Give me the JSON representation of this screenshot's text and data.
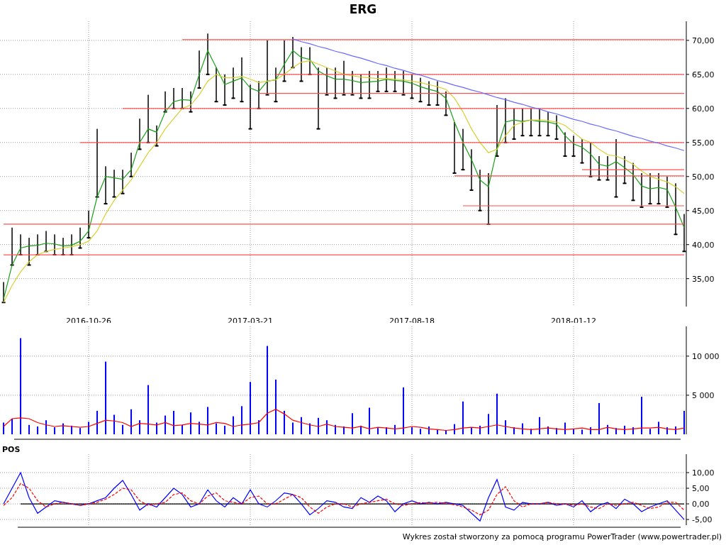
{
  "title": "ERG",
  "price_panel": {
    "chart_data": {
      "type": "line",
      "grid": true,
      "ylim": [
        30.9,
        72.8
      ],
      "categories": [
        null,
        null,
        null,
        null,
        null,
        null,
        null,
        null,
        null,
        null,
        "2016-10-26",
        null,
        null,
        null,
        null,
        null,
        null,
        null,
        null,
        null,
        null,
        null,
        null,
        null,
        null,
        null,
        null,
        null,
        null,
        "2017-03-21",
        null,
        null,
        null,
        null,
        null,
        null,
        null,
        null,
        null,
        null,
        null,
        null,
        null,
        null,
        null,
        null,
        null,
        null,
        "2017-08-18",
        null,
        null,
        null,
        null,
        null,
        null,
        null,
        null,
        null,
        null,
        null,
        null,
        null,
        null,
        null,
        null,
        null,
        null,
        "2018-01-12",
        null,
        null,
        null,
        null,
        null,
        null,
        null,
        null,
        null,
        null,
        null,
        null,
        null
      ],
      "yticks": [
        {
          "value": 35,
          "label": "35,00"
        },
        {
          "value": 40,
          "label": "40,00"
        },
        {
          "value": 45,
          "label": "45,00"
        },
        {
          "value": 50,
          "label": "50,00"
        },
        {
          "value": 55,
          "label": "55,00"
        },
        {
          "value": 60,
          "label": "60,00"
        },
        {
          "value": 65,
          "label": "65,00"
        },
        {
          "value": 70,
          "label": "70,00"
        }
      ],
      "series": [
        {
          "type": "area",
          "color": "#000000",
          "values": [
            34.5,
            42.5,
            41.5,
            41,
            41.5,
            42,
            41.5,
            41,
            41.5,
            42.5,
            45,
            57,
            51.5,
            51,
            51,
            53.5,
            58.5,
            62,
            57.5,
            62.5,
            63,
            63,
            62.5,
            68.5,
            71,
            66,
            65,
            66,
            67.5,
            63.5,
            64,
            70,
            66,
            70,
            70.5,
            69,
            69,
            66,
            66,
            66,
            67,
            65.5,
            65,
            65.5,
            65.5,
            66,
            65.5,
            65.5,
            65,
            64.5,
            64,
            64,
            62.5,
            58,
            57,
            54,
            51,
            50.5,
            60.5,
            61.5,
            60,
            60,
            60,
            60,
            59.5,
            59,
            56.5,
            56,
            55.5,
            55,
            53,
            53,
            55.5,
            53,
            52,
            50.5,
            50.5,
            50.5,
            50,
            49,
            44.5
          ]
        },
        {
          "type": "scatter",
          "color": "#000000",
          "values": [
            31.5,
            37,
            38.5,
            37,
            38.5,
            39,
            38.5,
            38.5,
            38.5,
            39.5,
            41,
            47,
            46,
            47,
            47.5,
            50,
            54,
            55,
            54.5,
            59.5,
            60,
            60,
            59.5,
            63,
            65,
            61,
            60.5,
            61.5,
            61,
            57,
            60,
            62,
            61,
            64,
            66,
            64,
            65,
            57,
            62,
            61.5,
            62,
            62,
            61.5,
            61.5,
            62.5,
            62.5,
            62.5,
            62,
            61.5,
            61,
            60.5,
            60.5,
            59,
            50.5,
            51,
            48,
            45,
            43,
            53,
            55,
            55.5,
            56,
            56,
            56,
            56,
            55.5,
            53,
            53,
            52,
            50,
            49.5,
            49.5,
            47,
            49,
            46.5,
            45.5,
            46,
            46,
            45.5,
            41.5,
            39
          ]
        },
        {
          "line_style": "solid",
          "color": "#1aa01a",
          "values": [
            32,
            37,
            39.5,
            39.8,
            39.9,
            40.2,
            40.1,
            39.8,
            39.9,
            40.5,
            42,
            47,
            50,
            49.8,
            49.6,
            51,
            55,
            57,
            56.5,
            59.5,
            61,
            61.3,
            61.2,
            65,
            68.5,
            66,
            63.5,
            64,
            64.5,
            63,
            62.5,
            64,
            64.2,
            66.5,
            68.5,
            67.5,
            67.2,
            65.5,
            64.8,
            64.3,
            64.3,
            64.1,
            63.8,
            63.9,
            64,
            64.3,
            64.1,
            64,
            63.7,
            63.2,
            62.8,
            62.5,
            61.5,
            58,
            55,
            52.5,
            49.5,
            48.5,
            54,
            58,
            58.3,
            58.1,
            58.3,
            58.1,
            58,
            57.7,
            56,
            54.8,
            54.3,
            53.3,
            51.8,
            51.5,
            52.2,
            51.3,
            50.3,
            48.6,
            48.2,
            48.4,
            48.1,
            45.5,
            42.5
          ]
        },
        {
          "line_style": "solid",
          "color": "#d8d030",
          "values": [
            31.5,
            34,
            36,
            37.5,
            38.5,
            39,
            39.3,
            39.5,
            39.7,
            40,
            40.5,
            42,
            44.5,
            46.5,
            48,
            49.5,
            51.5,
            53.5,
            55,
            57,
            58.5,
            60,
            60.5,
            62,
            64,
            65,
            64.5,
            64.5,
            64.7,
            64.3,
            63.8,
            64,
            64.2,
            65,
            66,
            66.8,
            67,
            66.5,
            66,
            65.5,
            65,
            64.8,
            64.6,
            64.5,
            64.4,
            64.4,
            64.3,
            64.2,
            64,
            63.8,
            63.5,
            63.2,
            62.8,
            61.5,
            59.5,
            57,
            55,
            53.5,
            54,
            56,
            57.5,
            58,
            58.3,
            58.3,
            58.2,
            58,
            57.5,
            56.5,
            55.5,
            55,
            54,
            53.2,
            53,
            52.5,
            51.8,
            50.8,
            50,
            49.6,
            49.2,
            48.5,
            47.5
          ]
        },
        {
          "line_style": "solid",
          "color": "#ff5050",
          "values": [
            null,
            null,
            null,
            null,
            null,
            null,
            null,
            null,
            null,
            null,
            null,
            null,
            null,
            null,
            null,
            null,
            null,
            null,
            null,
            null,
            null,
            70.1,
            70.1,
            70.1,
            70.1,
            70.1,
            70.1,
            70.1,
            70.1,
            70.1,
            70.1,
            70.1,
            70.1,
            70.1,
            70.1,
            70.1,
            70.1,
            70.1,
            70.1,
            70.1,
            70.1,
            70.1,
            70.1,
            70.1,
            70.1,
            70.1,
            70.1,
            70.1,
            70.1,
            70.1,
            70.1,
            70.1,
            70.1,
            70.1,
            70.1,
            70.1,
            70.1,
            70.1,
            70.1,
            70.1,
            70.1,
            70.1,
            70.1,
            70.1,
            70.1,
            70.1,
            70.1,
            70.1,
            70.1,
            70.1,
            70.1,
            70.1,
            70.1,
            70.1,
            70.1,
            70.1,
            70.1,
            70.1,
            70.1,
            70.1,
            70.1
          ]
        },
        {
          "line_style": "solid",
          "color": "#ff5050",
          "values": [
            null,
            null,
            null,
            null,
            null,
            null,
            null,
            null,
            null,
            null,
            null,
            null,
            null,
            null,
            null,
            null,
            null,
            null,
            null,
            null,
            null,
            null,
            null,
            null,
            null,
            null,
            null,
            null,
            null,
            null,
            null,
            null,
            65,
            65,
            65,
            65,
            65,
            65,
            65,
            65,
            65,
            65,
            65,
            65,
            65,
            65,
            65,
            65,
            65,
            65,
            65,
            65,
            65,
            65,
            65,
            65,
            65,
            65,
            65,
            65,
            65,
            65,
            65,
            65,
            65,
            65,
            65,
            65,
            65,
            65,
            65,
            65,
            65,
            65,
            65,
            65,
            65,
            65,
            65,
            65,
            65
          ]
        },
        {
          "line_style": "solid",
          "color": "#ff5050",
          "values": [
            null,
            null,
            null,
            null,
            null,
            null,
            null,
            null,
            null,
            null,
            null,
            null,
            null,
            null,
            null,
            null,
            null,
            null,
            null,
            null,
            null,
            null,
            null,
            null,
            null,
            null,
            null,
            null,
            null,
            null,
            62.2,
            62.2,
            62.2,
            62.2,
            62.2,
            62.2,
            62.2,
            62.2,
            62.2,
            62.2,
            62.2,
            62.2,
            62.2,
            62.2,
            62.2,
            62.2,
            62.2,
            62.2,
            62.2,
            62.2,
            62.2,
            62.2,
            62.2,
            62.2,
            62.2,
            62.2,
            62.2,
            62.2,
            62.2,
            62.2,
            62.2,
            62.2,
            62.2,
            62.2,
            62.2,
            62.2,
            62.2,
            62.2,
            62.2,
            62.2,
            62.2,
            62.2,
            62.2,
            62.2,
            62.2,
            62.2,
            62.2,
            62.2,
            62.2,
            62.2,
            62.2
          ]
        },
        {
          "line_style": "solid",
          "color": "#ff5050",
          "values": [
            null,
            null,
            null,
            null,
            null,
            null,
            null,
            null,
            null,
            null,
            null,
            null,
            null,
            null,
            60,
            60,
            60,
            60,
            60,
            60,
            60,
            60,
            60,
            60,
            60,
            60,
            60,
            60,
            60,
            60,
            60,
            60,
            60,
            60,
            60,
            60,
            60,
            60,
            60,
            60,
            60,
            60,
            60,
            60,
            60,
            60,
            60,
            60,
            60,
            60,
            60,
            60,
            60,
            60,
            60,
            60,
            60,
            60,
            60,
            60,
            60,
            60,
            60,
            60,
            60,
            60,
            60,
            60,
            60,
            60,
            60,
            60,
            60,
            60,
            60,
            60,
            60,
            60,
            60,
            60,
            60
          ]
        },
        {
          "line_style": "solid",
          "color": "#ff5050",
          "values": [
            null,
            null,
            null,
            null,
            null,
            null,
            null,
            null,
            null,
            55,
            55,
            55,
            55,
            55,
            55,
            55,
            55,
            55,
            55,
            55,
            55,
            55,
            55,
            55,
            55,
            55,
            55,
            55,
            55,
            55,
            55,
            55,
            55,
            55,
            55,
            55,
            55,
            55,
            55,
            55,
            55,
            55,
            55,
            55,
            55,
            55,
            55,
            55,
            55,
            55,
            55,
            55,
            55,
            55,
            55,
            55,
            55,
            55,
            55,
            55,
            55,
            55,
            55,
            55,
            55,
            55,
            55,
            55,
            55,
            55,
            55,
            55,
            55,
            55,
            55,
            55,
            55,
            55,
            55,
            55,
            55
          ]
        },
        {
          "line_style": "solid",
          "color": "#ff5050",
          "values": [
            null,
            null,
            null,
            null,
            null,
            null,
            null,
            null,
            null,
            null,
            null,
            null,
            null,
            null,
            null,
            null,
            null,
            null,
            null,
            null,
            null,
            null,
            null,
            null,
            null,
            null,
            null,
            null,
            null,
            null,
            null,
            null,
            null,
            null,
            null,
            null,
            null,
            null,
            null,
            null,
            null,
            null,
            null,
            null,
            null,
            null,
            null,
            null,
            null,
            null,
            null,
            null,
            null,
            null,
            null,
            null,
            null,
            null,
            null,
            null,
            null,
            null,
            null,
            null,
            null,
            null,
            null,
            null,
            51,
            51,
            51,
            51,
            51,
            51,
            51,
            51,
            51,
            51,
            51,
            51,
            51
          ]
        },
        {
          "line_style": "solid",
          "color": "#ff5050",
          "values": [
            null,
            null,
            null,
            null,
            null,
            null,
            null,
            null,
            null,
            null,
            null,
            null,
            null,
            null,
            null,
            null,
            null,
            null,
            null,
            null,
            null,
            null,
            null,
            null,
            null,
            null,
            null,
            null,
            null,
            null,
            null,
            null,
            null,
            null,
            null,
            null,
            null,
            null,
            null,
            null,
            null,
            null,
            null,
            null,
            null,
            null,
            null,
            null,
            null,
            null,
            null,
            null,
            null,
            50.1,
            50.1,
            50.1,
            50.1,
            50.1,
            50.1,
            50.1,
            50.1,
            50.1,
            50.1,
            50.1,
            50.1,
            50.1,
            50.1,
            50.1,
            50.1,
            50.1,
            50.1,
            50.1,
            50.1,
            50.1,
            50.1,
            50.1,
            50.1,
            50.1,
            50.1,
            50.1,
            50.1
          ]
        },
        {
          "line_style": "solid",
          "color": "#ff5050",
          "values": [
            null,
            null,
            null,
            null,
            null,
            null,
            null,
            null,
            null,
            null,
            null,
            null,
            null,
            null,
            null,
            null,
            null,
            null,
            null,
            null,
            null,
            null,
            null,
            null,
            null,
            null,
            null,
            null,
            null,
            null,
            null,
            null,
            null,
            null,
            null,
            null,
            null,
            null,
            null,
            null,
            null,
            null,
            null,
            null,
            null,
            null,
            null,
            null,
            null,
            null,
            null,
            null,
            null,
            null,
            45.7,
            45.7,
            45.7,
            45.7,
            45.7,
            45.7,
            45.7,
            45.7,
            45.7,
            45.7,
            45.7,
            45.7,
            45.7,
            45.7,
            45.7,
            45.7,
            45.7,
            45.7,
            45.7,
            45.7,
            45.7,
            45.7,
            45.7,
            45.7,
            45.7,
            45.7,
            45.7
          ]
        },
        {
          "line_style": "solid",
          "color": "#ff5050",
          "values": [
            43,
            43,
            43,
            43,
            43,
            43,
            43,
            43,
            43,
            43,
            43,
            43,
            43,
            43,
            43,
            43,
            43,
            43,
            43,
            43,
            43,
            43,
            43,
            43,
            43,
            43,
            43,
            43,
            43,
            43,
            43,
            43,
            43,
            43,
            43,
            43,
            43,
            43,
            43,
            43,
            43,
            43,
            43,
            43,
            43,
            43,
            43,
            43,
            43,
            43,
            43,
            43,
            43,
            43,
            43,
            43,
            43,
            43,
            43,
            43,
            43,
            43,
            43,
            43,
            43,
            43,
            43,
            43,
            43,
            43,
            43,
            43,
            43,
            43,
            43,
            43,
            43,
            43,
            43,
            43,
            43
          ]
        },
        {
          "line_style": "solid",
          "color": "#ff5050",
          "values": [
            38.5,
            38.5,
            38.5,
            38.5,
            38.5,
            38.5,
            38.5,
            38.5,
            38.5,
            38.5,
            38.5,
            38.5,
            38.5,
            38.5,
            38.5,
            38.5,
            38.5,
            38.5,
            38.5,
            38.5,
            38.5,
            38.5,
            38.5,
            38.5,
            38.5,
            38.5,
            38.5,
            38.5,
            38.5,
            38.5,
            38.5,
            38.5,
            38.5,
            38.5,
            38.5,
            38.5,
            38.5,
            38.5,
            38.5,
            38.5,
            38.5,
            38.5,
            38.5,
            38.5,
            38.5,
            38.5,
            38.5,
            38.5,
            38.5,
            38.5,
            38.5,
            38.5,
            38.5,
            38.5,
            38.5,
            38.5,
            38.5,
            38.5,
            38.5,
            38.5,
            38.5,
            38.5,
            38.5,
            38.5,
            38.5,
            38.5,
            38.5,
            38.5,
            38.5,
            38.5,
            38.5,
            38.5,
            38.5,
            38.5,
            38.5,
            38.5,
            38.5,
            38.5,
            38.5,
            38.5,
            38.5
          ]
        },
        {
          "line_style": "solid",
          "color": "#6a6aff",
          "values": [
            null,
            null,
            null,
            null,
            null,
            null,
            null,
            null,
            null,
            null,
            null,
            null,
            null,
            null,
            null,
            null,
            null,
            null,
            null,
            null,
            null,
            null,
            null,
            null,
            null,
            null,
            null,
            null,
            null,
            null,
            null,
            null,
            null,
            null,
            70.2,
            69.8,
            69.5,
            69.1,
            68.8,
            68.4,
            68.1,
            67.7,
            67.4,
            67,
            66.6,
            66.3,
            65.9,
            65.6,
            65.2,
            64.9,
            64.5,
            64.1,
            63.8,
            63.4,
            63.1,
            62.7,
            62.4,
            62,
            61.6,
            61.3,
            60.9,
            60.6,
            60.2,
            59.9,
            59.5,
            59.2,
            58.8,
            58.4,
            58.1,
            57.7,
            57.4,
            57,
            56.7,
            56.3,
            55.9,
            55.6,
            55.2,
            54.9,
            54.5,
            54.2,
            53.8
          ]
        }
      ]
    }
  },
  "volume_panel": {
    "chart_data": {
      "type": "bar",
      "grid": true,
      "ylim": [
        0,
        13800
      ],
      "yticks": [
        {
          "value": 5000,
          "label": "5 000"
        },
        {
          "value": 10000,
          "label": "10 000"
        }
      ],
      "series": [
        {
          "color": "#0000ff",
          "values": [
            1500,
            2000,
            12300,
            1200,
            1000,
            1800,
            900,
            1400,
            1100,
            800,
            1600,
            3000,
            9300,
            2500,
            1200,
            3200,
            1800,
            6300,
            1500,
            2400,
            3000,
            1200,
            2800,
            1600,
            3500,
            1400,
            1100,
            2300,
            3600,
            6700,
            1800,
            11300,
            7000,
            3000,
            1500,
            2200,
            1400,
            2100,
            1800,
            1200,
            1000,
            2700,
            1100,
            3400,
            800,
            900,
            1200,
            6000,
            900,
            700,
            1000,
            600,
            500,
            1300,
            4200,
            900,
            1100,
            2600,
            5200,
            1800,
            900,
            1400,
            700,
            2200,
            1000,
            800,
            1500,
            700,
            600,
            900,
            4000,
            1200,
            800,
            1100,
            900,
            4800,
            700,
            1600,
            900,
            1000,
            3000
          ]
        },
        {
          "type": "line",
          "line_style": "solid",
          "color": "#ff0000",
          "values": [
            1000,
            2000,
            2100,
            2000,
            1500,
            1200,
            1000,
            1100,
            1000,
            900,
            1000,
            1400,
            1800,
            1700,
            1500,
            1000,
            1400,
            1300,
            1200,
            1500,
            1100,
            1200,
            1400,
            1300,
            1200,
            1500,
            1400,
            1000,
            1200,
            1300,
            1500,
            2700,
            3200,
            2600,
            1800,
            1500,
            1200,
            1000,
            1300,
            1000,
            900,
            800,
            1000,
            700,
            900,
            800,
            700,
            800,
            1000,
            900,
            700,
            600,
            500,
            600,
            800,
            900,
            800,
            1000,
            1200,
            1000,
            800,
            700,
            600,
            700,
            800,
            700,
            600,
            700,
            800,
            600,
            600,
            900,
            700,
            600,
            700,
            800,
            800,
            900,
            700,
            600,
            800
          ]
        }
      ]
    }
  },
  "pos_panel": {
    "label": "POS",
    "chart_data": {
      "type": "line",
      "grid": true,
      "ylim": [
        -6.8,
        15.9
      ],
      "yticks": [
        {
          "value": -5,
          "label": "-5,00"
        },
        {
          "value": 0,
          "label": "0,00"
        },
        {
          "value": 5,
          "label": "5,00"
        },
        {
          "value": 10,
          "label": "10,00"
        }
      ],
      "series": [
        {
          "line_style": "solid",
          "color": "#000000",
          "values": [
            null,
            null,
            0,
            0,
            0,
            0,
            0,
            0,
            0,
            0,
            0,
            0,
            0,
            0,
            0,
            0,
            0,
            0,
            0,
            0,
            0,
            0,
            0,
            0,
            0,
            0,
            0,
            0,
            0,
            0,
            0,
            0,
            0,
            0,
            0,
            0,
            0,
            0,
            0,
            0,
            0,
            0,
            0,
            0,
            0,
            0,
            0,
            0,
            0,
            0,
            0,
            0,
            0,
            0,
            0,
            0,
            0,
            0,
            0,
            0,
            0,
            0,
            0,
            0,
            0,
            0,
            0,
            0,
            0,
            0,
            0,
            0,
            0,
            0,
            0,
            0,
            0,
            0,
            0,
            0,
            0
          ]
        },
        {
          "line_style": "solid",
          "color": "#0000ff",
          "values": [
            0,
            5,
            10,
            2,
            -3,
            -1,
            1,
            0.5,
            0,
            -0.5,
            0,
            1,
            2,
            5,
            7.5,
            3,
            -2,
            0,
            -1,
            2,
            5,
            3,
            -1,
            0,
            4.5,
            1,
            -1,
            2,
            0,
            4.5,
            0,
            -1,
            1,
            3.5,
            3,
            0,
            -3.5,
            -1.5,
            1,
            0.5,
            -1,
            -1.5,
            2,
            0.5,
            2.5,
            1,
            -2.5,
            0,
            1,
            0,
            0.5,
            0,
            0.5,
            0,
            -0.5,
            -3,
            -5.5,
            2,
            7.8,
            -1,
            -2,
            0.5,
            0,
            0,
            0.5,
            -0.5,
            0,
            -1,
            1,
            -2.5,
            -0.5,
            0.5,
            -1.5,
            1.5,
            0,
            -2.5,
            -1,
            0,
            1,
            -2,
            -5
          ]
        },
        {
          "line_style": "dashed",
          "color": "#ff0000",
          "values": [
            -0.5,
            2,
            6.5,
            5,
            1,
            -1,
            0,
            0.5,
            0,
            -0.5,
            0,
            0.5,
            1.5,
            3,
            5,
            4.5,
            1,
            -0.5,
            0,
            0.5,
            3,
            3.5,
            1,
            0,
            2.5,
            3.5,
            1,
            0.5,
            0,
            2,
            2.5,
            0,
            0,
            1.5,
            3,
            2,
            -1,
            -3,
            -1,
            0,
            0,
            -1,
            0,
            0.5,
            1,
            1.5,
            0,
            -0.5,
            0,
            0.4,
            0.3,
            0.5,
            0.2,
            -0.3,
            -1,
            -2,
            -3.5,
            -2,
            3,
            5.5,
            1,
            -1,
            0,
            0,
            0.5,
            0,
            0,
            -0.5,
            0,
            -1,
            -1.5,
            0,
            -0.5,
            0,
            0.5,
            -0.5,
            -1.5,
            -1,
            0.5,
            0.5,
            -2
          ]
        }
      ]
    }
  },
  "footer": "Wykres został stworzony za pomocą programu PowerTrader (www.powertrader.pl)"
}
